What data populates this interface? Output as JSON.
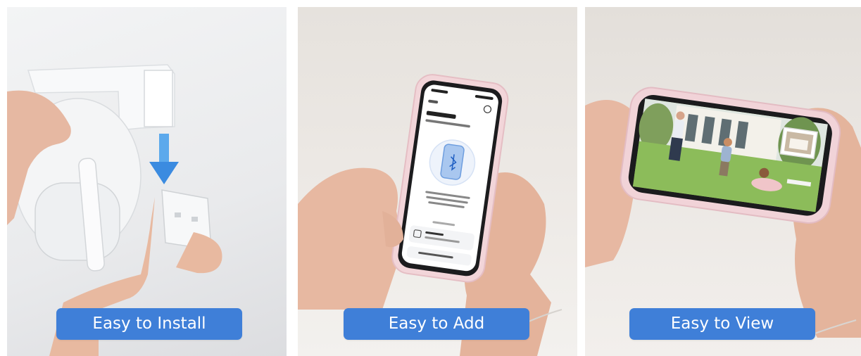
{
  "panels": [
    {
      "caption": "Easy to Install"
    },
    {
      "caption": "Easy to Add"
    },
    {
      "caption": "Easy to View"
    }
  ]
}
